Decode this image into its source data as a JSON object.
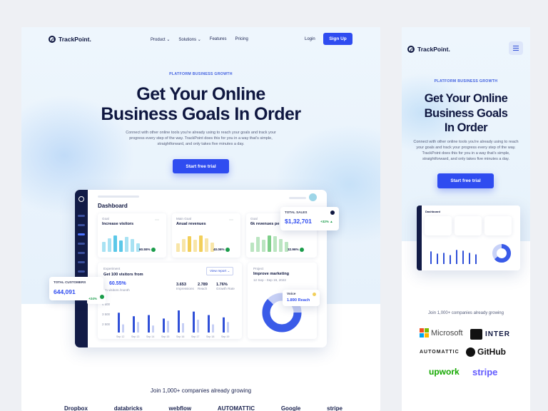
{
  "brand": {
    "name": "TrackPoint."
  },
  "nav": {
    "items": [
      {
        "label": "Product",
        "caret": true
      },
      {
        "label": "Solutions",
        "caret": true
      },
      {
        "label": "Features",
        "caret": false
      },
      {
        "label": "Pricing",
        "caret": false
      }
    ],
    "login": "Login",
    "signup": "Sign Up"
  },
  "hero": {
    "eyebrow": "PLATFORM BUSINESS GROWTH",
    "title_line1": "Get Your Online",
    "title_line2": "Business Goals In Order",
    "subtitle": "Connect with other online tools you're already using to reach your goals and track your progress every step of the way. TrackPoint does this for you in a way that's simple, straightforward, and only takes five minutes a day.",
    "cta": "Start free trial"
  },
  "dashboard": {
    "title": "Dashboard",
    "goals": [
      {
        "eyebrow": "Goal",
        "title": "Increase visitors",
        "value": "60.55%",
        "color": "#5bc8e8",
        "bars": [
          0.55,
          0.75,
          0.9,
          0.6,
          0.8,
          0.7,
          0.45
        ],
        "highlight": [
          2,
          3
        ]
      },
      {
        "eyebrow": "Main Goal",
        "title": "Anual revenues",
        "value": "40.06%",
        "color": "#f2cf5a",
        "bars": [
          0.45,
          0.7,
          0.85,
          0.65,
          0.9,
          0.75,
          0.5
        ],
        "highlight": [
          2,
          4
        ]
      },
      {
        "eyebrow": "Goal",
        "title": "6k revenues pe",
        "value": "32.96%",
        "color": "#7fcf8a",
        "bars": [
          0.5,
          0.8,
          0.65,
          0.9,
          0.85,
          0.7,
          0.55
        ],
        "highlight": [
          3
        ]
      }
    ],
    "total_sales": {
      "label": "TOTAL SALES",
      "value": "$1,32,701",
      "change": "+32%"
    },
    "total_customers": {
      "label": "TOTAL CUSTOMERS",
      "value": "644,091",
      "change": "+24%"
    },
    "experiment": {
      "eyebrow": "Experiment",
      "title": "Get 100 visitors from",
      "view_report": "View report",
      "pct": "60.55%",
      "pct_label": "m visitors /month",
      "stats": [
        {
          "value": "3.653",
          "label": "Impressions"
        },
        {
          "value": "2.789",
          "label": "Reach"
        },
        {
          "value": "1.76%",
          "label": "Growth Rate"
        }
      ],
      "y_ticks": [
        "4 500",
        "3 500",
        "2 500"
      ],
      "x_ticks": [
        "Sep 12",
        "Sep 13",
        "Sep 14",
        "Sep 15",
        "Sep 16",
        "Sep 17",
        "Sep 18",
        "Sep 19"
      ],
      "chart_data": {
        "type": "bar",
        "categories": [
          "Sep 12",
          "Sep 13",
          "Sep 14",
          "Sep 15",
          "Sep 16",
          "Sep 17",
          "Sep 18",
          "Sep 19"
        ],
        "series": [
          {
            "values": [
              3700,
              3400,
              3500,
              3200,
              3900,
              3800,
              3500,
              3300
            ]
          },
          {
            "values": [
              2700,
              2900,
              2600,
              3000,
              2800,
              3100,
              2700,
              2900
            ]
          }
        ],
        "ylim": [
          2000,
          4700
        ]
      }
    },
    "project": {
      "eyebrow": "Project",
      "title": "Improve marketing",
      "dates": "12 Sep - Sep 19, 2022",
      "legend_label": "Voice",
      "legend_value": "1.890 Reach",
      "donut": [
        0.38,
        0.62
      ]
    }
  },
  "companies": {
    "tagline": "Join 1,000+ companies already growing",
    "logos": [
      "Microsoft",
      "INTER",
      "AUTOMATTIC",
      "GitHub",
      "upwork",
      "stripe"
    ],
    "desktop_strip": [
      "Dropbox",
      "databricks",
      "webflow",
      "AUTOMATTIC",
      "Google",
      "stripe"
    ]
  },
  "mobile": {
    "title_line1": "Get Your Online",
    "title_line2": "Business Goals",
    "title_line3": "In Order"
  },
  "colors": {
    "primary": "#2f4cf0",
    "navy": "#0f1740",
    "green": "#1a9c4a"
  }
}
